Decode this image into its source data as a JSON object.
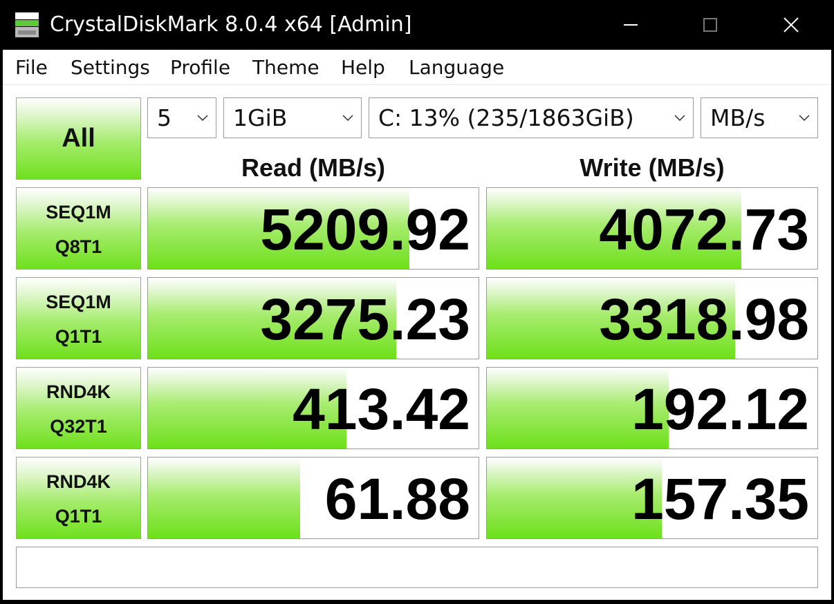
{
  "window": {
    "title": "CrystalDiskMark 8.0.4 x64 [Admin]",
    "icon": "disk-drive-icon",
    "controls": [
      "minimize-icon",
      "maximize-icon",
      "close-icon"
    ]
  },
  "menu": {
    "items": [
      "File",
      "Settings",
      "Profile",
      "Theme",
      "Help",
      "Language"
    ]
  },
  "controls": {
    "all_label": "All",
    "count": "5",
    "size": "1GiB",
    "drive": "C: 13% (235/1863GiB)",
    "unit": "MB/s"
  },
  "headers": {
    "read": "Read (MB/s)",
    "write": "Write (MB/s)"
  },
  "tests": [
    {
      "line1": "SEQ1M",
      "line2": "Q8T1",
      "read": "5209.92",
      "write": "4072.73",
      "read_fill": 0.79,
      "write_fill": 0.77
    },
    {
      "line1": "SEQ1M",
      "line2": "Q1T1",
      "read": "3275.23",
      "write": "3318.98",
      "read_fill": 0.75,
      "write_fill": 0.75
    },
    {
      "line1": "RND4K",
      "line2": "Q32T1",
      "read": "413.42",
      "write": "192.12",
      "read_fill": 0.6,
      "write_fill": 0.55
    },
    {
      "line1": "RND4K",
      "line2": "Q1T1",
      "read": "61.88",
      "write": "157.35",
      "read_fill": 0.46,
      "write_fill": 0.53
    }
  ],
  "status": "",
  "colors": {
    "accent_green": "#6de01a",
    "titlebar": "#000000"
  }
}
